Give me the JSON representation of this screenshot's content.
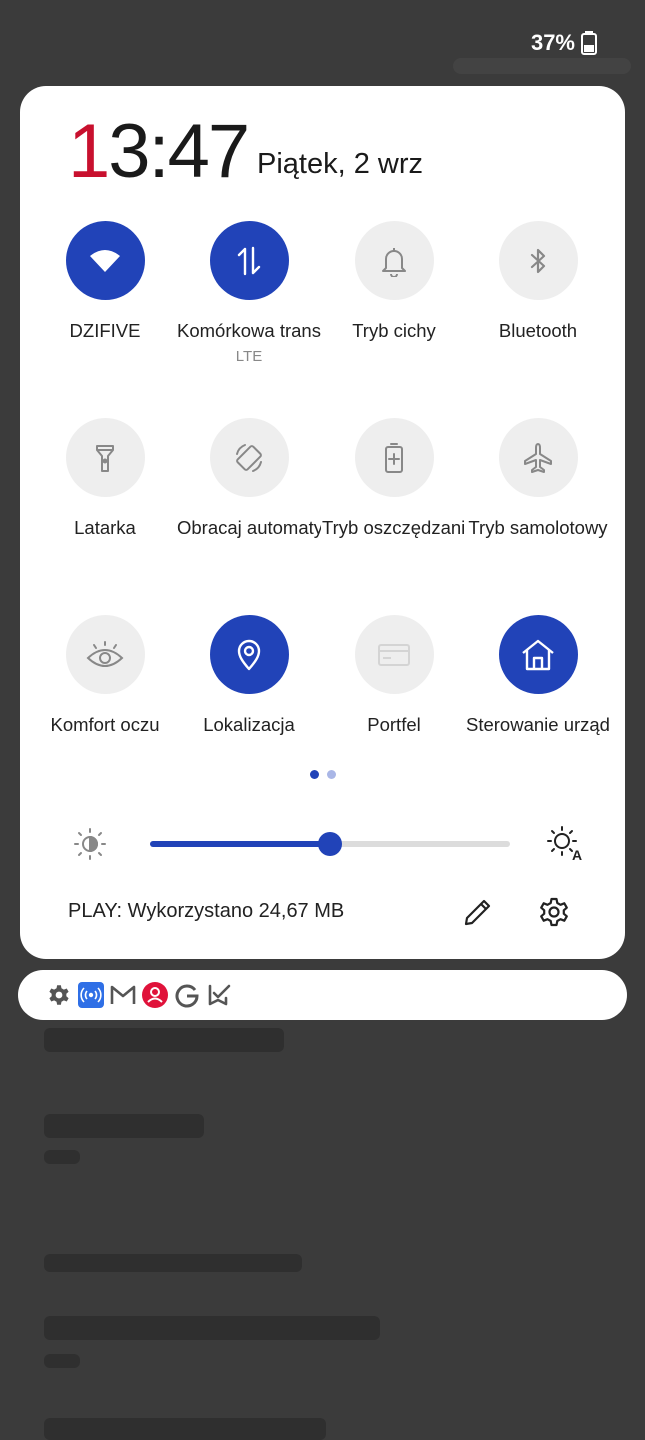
{
  "status": {
    "battery": "37%"
  },
  "clock": {
    "time_first": "1",
    "time_rest": "3:47",
    "date": "Piątek, 2 wrz"
  },
  "tiles": [
    {
      "label": "DZIFIVE",
      "sub": "",
      "on": true,
      "icon": "wifi-icon"
    },
    {
      "label": "Komórkowa transmisja danych",
      "sub": "LTE",
      "on": true,
      "icon": "mobile-data-icon"
    },
    {
      "label": "Tryb cichy",
      "sub": "",
      "on": false,
      "icon": "bell-icon"
    },
    {
      "label": "Bluetooth",
      "sub": "",
      "on": false,
      "icon": "bluetooth-icon"
    },
    {
      "label": "Latarka",
      "sub": "",
      "on": false,
      "icon": "flashlight-icon"
    },
    {
      "label": "Obracaj automatycznie",
      "sub": "",
      "on": false,
      "icon": "auto-rotate-icon"
    },
    {
      "label": "Tryb oszczędzania baterii",
      "sub": "",
      "on": false,
      "icon": "battery-saver-icon"
    },
    {
      "label": "Tryb samolotowy",
      "sub": "",
      "on": false,
      "icon": "airplane-icon"
    },
    {
      "label": "Komfort oczu",
      "sub": "",
      "on": false,
      "icon": "eye-icon"
    },
    {
      "label": "Lokalizacja",
      "sub": "",
      "on": true,
      "icon": "location-icon"
    },
    {
      "label": "Portfel",
      "sub": "",
      "on": false,
      "icon": "wallet-icon"
    },
    {
      "label": "Sterowanie urządzeniami",
      "sub": "",
      "on": true,
      "icon": "home-icon"
    }
  ],
  "brightness": {
    "level": 0.5
  },
  "data_usage": "PLAY: Wykorzystano 24,67 MB",
  "colors": {
    "accent": "#2143b8",
    "clock_accent": "#c8102e"
  },
  "notifications": [
    "gear-icon",
    "hotspot-icon",
    "gmail-icon",
    "account-icon",
    "google-icon",
    "tasks-icon"
  ]
}
